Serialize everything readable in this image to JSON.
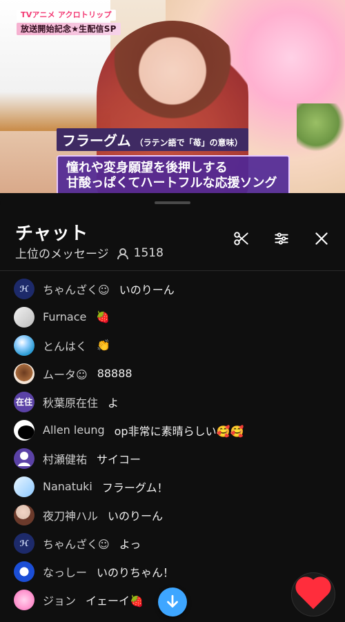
{
  "video": {
    "badge_line1": "TVアニメ アクロトリップ",
    "badge_line2": "放送開始記念★生配信SP",
    "caption_title": "フラーグム",
    "caption_title_note": "（ラテン語で「苺」の意味）",
    "caption_lines": [
      "憧れや変身願望を後押しする",
      "甘酸っぱくてハートフルな応援ソング"
    ]
  },
  "chat": {
    "title": "チャット",
    "subtitle": "上位のメッセージ",
    "viewer_count": "1518",
    "messages": [
      {
        "author": "ちゃんざく☺",
        "text": "いのりーん",
        "avatar": {
          "type": "text",
          "label": "ℋ",
          "bg": "#1d2a6a",
          "fg": "#dbe6ff"
        }
      },
      {
        "author": "Furnace",
        "text": "🍓",
        "avatar": {
          "type": "photo",
          "label": "",
          "bg": "#d7d7d7",
          "fg": "#000"
        }
      },
      {
        "author": "とんはく",
        "text": "👏",
        "avatar": {
          "type": "photo",
          "label": "",
          "bg": "#2b9bd3",
          "fg": "#000"
        }
      },
      {
        "author": "ムータ☺",
        "text": "88888",
        "avatar": {
          "type": "photo",
          "label": "",
          "bg": "#a86b3d",
          "fg": "#000"
        }
      },
      {
        "author": "秋葉原在住",
        "text": "よ",
        "avatar": {
          "type": "text",
          "label": "在住",
          "bg": "#5b42a6",
          "fg": "#ffffff"
        }
      },
      {
        "author": "Allen leung",
        "text": "op非常に素晴らしい🥰🥰",
        "avatar": {
          "type": "photo",
          "label": "",
          "bg": "#ffffff",
          "fg": "#000"
        }
      },
      {
        "author": "村瀬健祐",
        "text": "サイコー",
        "avatar": {
          "type": "text",
          "label": "●",
          "bg": "#5b42a6",
          "fg": "#ffffff"
        }
      },
      {
        "author": "Nanatuki",
        "text": "フラーグム！",
        "avatar": {
          "type": "photo",
          "label": "",
          "bg": "#cfe9ff",
          "fg": "#000"
        }
      },
      {
        "author": "夜刀神ハル",
        "text": "いのりーん",
        "avatar": {
          "type": "photo",
          "label": "",
          "bg": "#e1c5b5",
          "fg": "#000"
        }
      },
      {
        "author": "ちゃんざく☺",
        "text": "よっ",
        "avatar": {
          "type": "text",
          "label": "ℋ",
          "bg": "#1d2a6a",
          "fg": "#dbe6ff"
        }
      },
      {
        "author": "なっしー",
        "text": "いのりちゃん！",
        "avatar": {
          "type": "photo",
          "label": "",
          "bg": "#1b4ed6",
          "fg": "#000"
        }
      },
      {
        "author": "ジョン",
        "text": "イェーイ🍓",
        "avatar": {
          "type": "photo",
          "label": "",
          "bg": "#ff9ad1",
          "fg": "#000"
        }
      }
    ]
  },
  "icons": {
    "scissors": "scissors-icon",
    "filter": "sliders-icon",
    "close": "close-icon",
    "viewers": "user-icon",
    "scroll_down": "arrow-down-icon",
    "heart": "heart-icon"
  },
  "colors": {
    "accent_blue": "#3ea6ff",
    "heart_red": "#ff2d3c"
  }
}
